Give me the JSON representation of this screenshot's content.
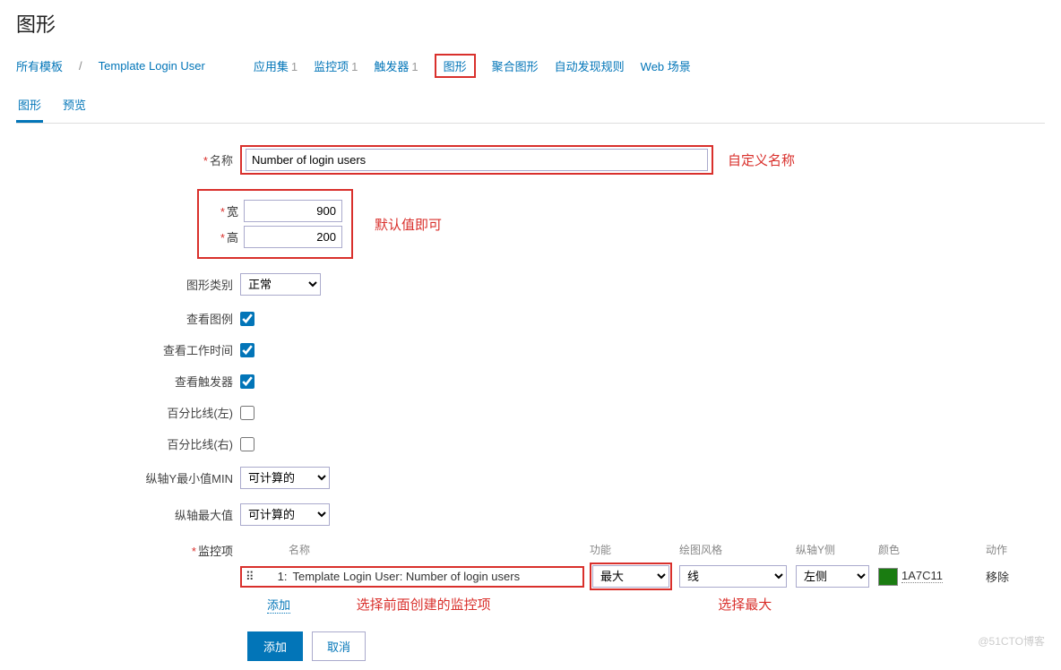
{
  "page_title": "图形",
  "breadcrumb": {
    "root": "所有模板",
    "template": "Template Login User"
  },
  "nav": {
    "apps": {
      "label": "应用集",
      "count": "1"
    },
    "items": {
      "label": "监控项",
      "count": "1"
    },
    "triggers": {
      "label": "触发器",
      "count": "1"
    },
    "graphs": {
      "label": "图形"
    },
    "screens": {
      "label": "聚合图形"
    },
    "discovery": {
      "label": "自动发现规则"
    },
    "web": {
      "label": "Web 场景"
    }
  },
  "subtabs": {
    "graph": "图形",
    "preview": "预览"
  },
  "form": {
    "name": {
      "label": "名称",
      "value": "Number of login users",
      "note": "自定义名称"
    },
    "width": {
      "label": "宽",
      "value": "900"
    },
    "height": {
      "label": "高",
      "value": "200"
    },
    "wh_note": "默认值即可",
    "graph_type": {
      "label": "图形类别",
      "value": "正常"
    },
    "legend": {
      "label": "查看图例",
      "checked": true
    },
    "worktime": {
      "label": "查看工作时间",
      "checked": true
    },
    "triggers_chk": {
      "label": "查看触发器",
      "checked": true
    },
    "pct_left": {
      "label": "百分比线(左)",
      "checked": false
    },
    "pct_right": {
      "label": "百分比线(右)",
      "checked": false
    },
    "ymin": {
      "label": "纵轴Y最小值MIN",
      "value": "可计算的"
    },
    "ymax": {
      "label": "纵轴最大值",
      "value": "可计算的"
    },
    "items_label": "监控项",
    "item_headers": {
      "name": "名称",
      "func": "功能",
      "draw": "绘图风格",
      "axis": "纵轴Y侧",
      "color": "颜色",
      "action": "动作"
    },
    "item_row": {
      "idx": "1:",
      "name": "Template Login User: Number of login users",
      "func": "最大",
      "draw": "线",
      "axis": "左侧",
      "color_hex": "1A7C11",
      "remove": "移除"
    },
    "add_link": "添加",
    "note_item": "选择前面创建的监控项",
    "note_func": "选择最大",
    "btn_add": "添加",
    "btn_cancel": "取消"
  },
  "watermark": "@51CTO博客"
}
